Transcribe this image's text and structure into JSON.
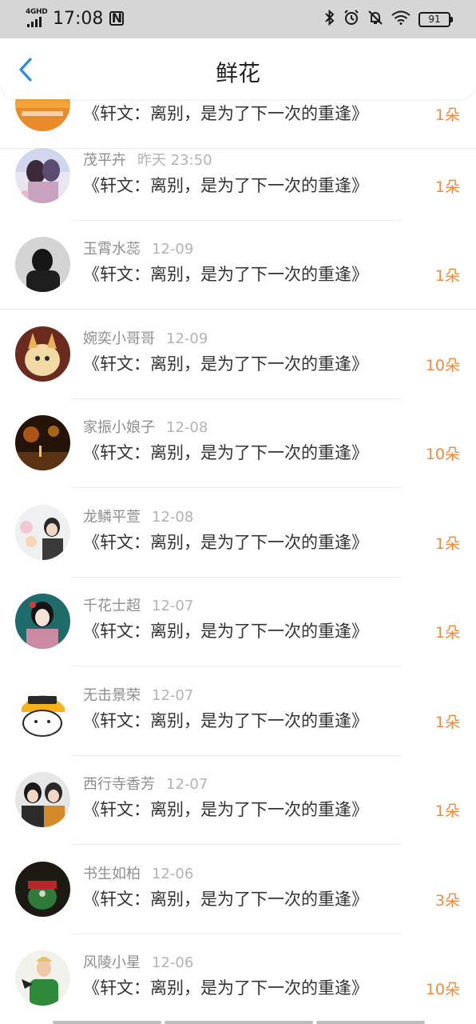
{
  "status_bar": {
    "network": "4GHD",
    "time": "17:08",
    "battery": "91"
  },
  "header": {
    "title": "鲜花"
  },
  "list": [
    {
      "name": "",
      "date": "",
      "book": "《轩文：离别，是为了下一次的重逢》",
      "qty": "1朵",
      "avatar": "avatar-cut",
      "partial": true
    },
    {
      "name": "茂平卉",
      "date": "昨天 23:50",
      "book": "《轩文：离别，是为了下一次的重逢》",
      "qty": "1朵",
      "avatar": "anime-couple"
    },
    {
      "name": "玉霄水蕊",
      "date": "12-09",
      "book": "《轩文：离别，是为了下一次的重逢》",
      "qty": "1朵",
      "avatar": "dark-figure"
    },
    {
      "name": "婉奕小哥哥",
      "date": "12-09",
      "book": "《轩文：离别，是为了下一次的重逢》",
      "qty": "10朵",
      "avatar": "cat-costume"
    },
    {
      "name": "家振小娘子",
      "date": "12-08",
      "book": "《轩文：离别，是为了下一次的重逢》",
      "qty": "10朵",
      "avatar": "night-street"
    },
    {
      "name": "龙鳞平萱",
      "date": "12-08",
      "book": "《轩文：离别，是为了下一次的重逢》",
      "qty": "1朵",
      "avatar": "girl-flowers"
    },
    {
      "name": "千花士超",
      "date": "12-07",
      "book": "《轩文：离别，是为了下一次的重逢》",
      "qty": "1朵",
      "avatar": "geisha"
    },
    {
      "name": "无击景荣",
      "date": "12-07",
      "book": "《轩文：离别，是为了下一次的重逢》",
      "qty": "1朵",
      "avatar": "cartoon-cat-helmet"
    },
    {
      "name": "西行寺香芳",
      "date": "12-07",
      "book": "《轩文：离别，是为了下一次的重逢》",
      "qty": "1朵",
      "avatar": "two-boys"
    },
    {
      "name": "书生如柏",
      "date": "12-06",
      "book": "《轩文：离别，是为了下一次的重逢》",
      "qty": "3朵",
      "avatar": "green-red"
    },
    {
      "name": "风陵小星",
      "date": "12-06",
      "book": "《轩文：离别，是为了下一次的重逢》",
      "qty": "10朵",
      "avatar": "green-shirt-person"
    }
  ],
  "colors": {
    "accent_qty": "#f08a3c",
    "back_arrow": "#2b8de8",
    "status_bar_bg": "#d6d6d6"
  }
}
